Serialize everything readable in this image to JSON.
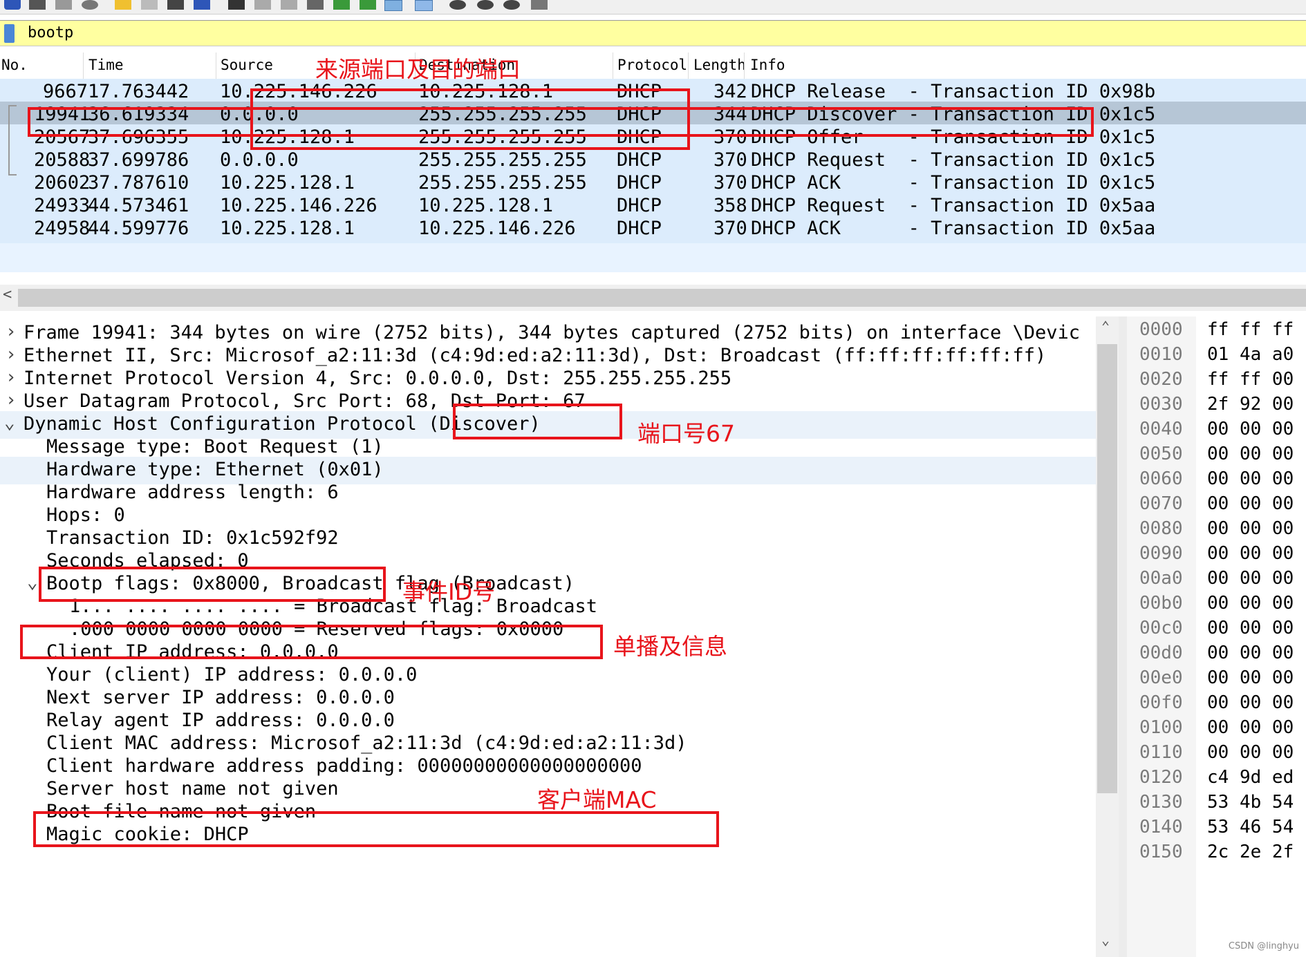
{
  "filter": {
    "value": "bootp"
  },
  "columns": [
    "No.",
    "Time",
    "Source",
    "Destination",
    "Protocol",
    "Length",
    "Info"
  ],
  "packets": [
    {
      "no": "9667",
      "time": "17.763442",
      "src": "10.225.146.226",
      "dst": "10.225.128.1",
      "proto": "DHCP",
      "len": "342",
      "info": "DHCP Release  - Transaction ID 0x98b"
    },
    {
      "no": "19941",
      "time": "36.619334",
      "src": "0.0.0.0",
      "dst": "255.255.255.255",
      "proto": "DHCP",
      "len": "344",
      "info": "DHCP Discover - Transaction ID 0x1c5"
    },
    {
      "no": "20567",
      "time": "37.696355",
      "src": "10.225.128.1",
      "dst": "255.255.255.255",
      "proto": "DHCP",
      "len": "370",
      "info": "DHCP Offer    - Transaction ID 0x1c5"
    },
    {
      "no": "20588",
      "time": "37.699786",
      "src": "0.0.0.0",
      "dst": "255.255.255.255",
      "proto": "DHCP",
      "len": "370",
      "info": "DHCP Request  - Transaction ID 0x1c5"
    },
    {
      "no": "20602",
      "time": "37.787610",
      "src": "10.225.128.1",
      "dst": "255.255.255.255",
      "proto": "DHCP",
      "len": "370",
      "info": "DHCP ACK      - Transaction ID 0x1c5"
    },
    {
      "no": "24933",
      "time": "44.573461",
      "src": "10.225.146.226",
      "dst": "10.225.128.1",
      "proto": "DHCP",
      "len": "358",
      "info": "DHCP Request  - Transaction ID 0x5aa"
    },
    {
      "no": "24958",
      "time": "44.599776",
      "src": "10.225.128.1",
      "dst": "10.225.146.226",
      "proto": "DHCP",
      "len": "370",
      "info": "DHCP ACK      - Transaction ID 0x5aa"
    }
  ],
  "tree": [
    {
      "text": "Frame 19941: 344 bytes on wire (2752 bits), 344 bytes captured (2752 bits) on interface \\Devic",
      "expander": "›"
    },
    {
      "text": "Ethernet II, Src: Microsof_a2:11:3d (c4:9d:ed:a2:11:3d), Dst: Broadcast (ff:ff:ff:ff:ff:ff)",
      "expander": "›"
    },
    {
      "text": "Internet Protocol Version 4, Src: 0.0.0.0, Dst: 255.255.255.255",
      "expander": "›"
    },
    {
      "text": "User Datagram Protocol, Src Port: 68, Dst Port: 67",
      "expander": "›"
    },
    {
      "text": "Dynamic Host Configuration Protocol (Discover)",
      "expander": "⌄"
    },
    {
      "text": "Message type: Boot Request (1)",
      "expander": ""
    },
    {
      "text": "Hardware type: Ethernet (0x01)",
      "expander": ""
    },
    {
      "text": "Hardware address length: 6",
      "expander": ""
    },
    {
      "text": "Hops: 0",
      "expander": ""
    },
    {
      "text": "Transaction ID: 0x1c592f92",
      "expander": ""
    },
    {
      "text": "Seconds elapsed: 0",
      "expander": ""
    },
    {
      "text": "Bootp flags: 0x8000, Broadcast flag (Broadcast)",
      "expander": "⌄"
    },
    {
      "text": "1... .... .... .... = Broadcast flag: Broadcast",
      "expander": ""
    },
    {
      "text": ".000 0000 0000 0000 = Reserved flags: 0x0000",
      "expander": ""
    },
    {
      "text": "Client IP address: 0.0.0.0",
      "expander": ""
    },
    {
      "text": "Your (client) IP address: 0.0.0.0",
      "expander": ""
    },
    {
      "text": "Next server IP address: 0.0.0.0",
      "expander": ""
    },
    {
      "text": "Relay agent IP address: 0.0.0.0",
      "expander": ""
    },
    {
      "text": "Client MAC address: Microsof_a2:11:3d (c4:9d:ed:a2:11:3d)",
      "expander": ""
    },
    {
      "text": "Client hardware address padding: 00000000000000000000",
      "expander": ""
    },
    {
      "text": "Server host name not given",
      "expander": ""
    },
    {
      "text": "Boot file name not given",
      "expander": ""
    },
    {
      "text": "Magic cookie: DHCP",
      "expander": ""
    }
  ],
  "hex": [
    {
      "off": "0000",
      "bytes": "ff ff ff"
    },
    {
      "off": "0010",
      "bytes": "01 4a a0"
    },
    {
      "off": "0020",
      "bytes": "ff ff 00"
    },
    {
      "off": "0030",
      "bytes": "2f 92 00"
    },
    {
      "off": "0040",
      "bytes": "00 00 00"
    },
    {
      "off": "0050",
      "bytes": "00 00 00"
    },
    {
      "off": "0060",
      "bytes": "00 00 00"
    },
    {
      "off": "0070",
      "bytes": "00 00 00"
    },
    {
      "off": "0080",
      "bytes": "00 00 00"
    },
    {
      "off": "0090",
      "bytes": "00 00 00"
    },
    {
      "off": "00a0",
      "bytes": "00 00 00"
    },
    {
      "off": "00b0",
      "bytes": "00 00 00"
    },
    {
      "off": "00c0",
      "bytes": "00 00 00"
    },
    {
      "off": "00d0",
      "bytes": "00 00 00"
    },
    {
      "off": "00e0",
      "bytes": "00 00 00"
    },
    {
      "off": "00f0",
      "bytes": "00 00 00"
    },
    {
      "off": "0100",
      "bytes": "00 00 00"
    },
    {
      "off": "0110",
      "bytes": "00 00 00"
    },
    {
      "off": "0120",
      "bytes": "c4 9d ed"
    },
    {
      "off": "0130",
      "bytes": "53 4b 54"
    },
    {
      "off": "0140",
      "bytes": "53 46 54"
    },
    {
      "off": "0150",
      "bytes": "2c 2e 2f"
    }
  ],
  "annotations": {
    "ports": "来源端口及目的端口",
    "port67": "端口号67",
    "txid": "事件ID号",
    "unicast": "单播及信息",
    "mac": "客户端MAC"
  },
  "watermark": "CSDN @linghyu",
  "scroll": {
    "left_arrow": "<",
    "up_arrow": "⌃",
    "down_arrow": "⌄"
  },
  "colors": {
    "annotation": "#e8141b",
    "selected_row": "#b6c6d6",
    "row": "#dcecfc",
    "filter_bg": "#ffffa0"
  }
}
